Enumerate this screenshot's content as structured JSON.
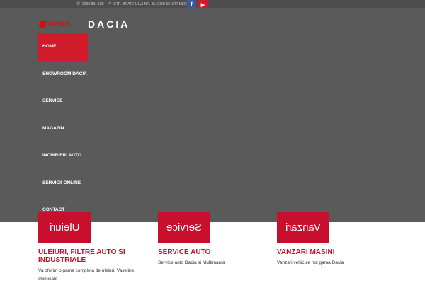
{
  "topbar": {
    "phone_icon": "phone-icon",
    "phone": "0269 831 188",
    "location_icon": "map-pin-icon",
    "address": "STR. BRATEIULUI NR. 35, COD 551047 MEDIAS",
    "facebook": "f",
    "youtube": "▶"
  },
  "logos": {
    "sanes": "SANES",
    "dacia": "DACIA"
  },
  "nav": {
    "items": [
      {
        "label": "HOME"
      },
      {
        "label": "SHOWROOM DACIA"
      },
      {
        "label": "SERVICE"
      },
      {
        "label": "MAGAZIN"
      },
      {
        "label": "INCHIRIERI AUTO"
      },
      {
        "label": "SERVICII ONLINE"
      },
      {
        "label": "CONTACT"
      }
    ]
  },
  "features": [
    {
      "banner": "Uleiuri",
      "title": "ULEIURI, FILTRE AUTO SI INDUSTRIALE",
      "text": "Va oferim o gama completa de uleiuri, Vaseline, chimicale"
    },
    {
      "banner": "Service",
      "title": "SERVICE AUTO",
      "text": "Service auto Dacia si Multimarca"
    },
    {
      "banner": "Vanzari",
      "title": "VANZARI MASINI",
      "text": "Vanzari vehicule noi gama Dacia"
    }
  ],
  "colors": {
    "accent": "#d01b2a",
    "header_bg": "#5a5a5a",
    "topbar_bg": "#4e4e4e"
  }
}
